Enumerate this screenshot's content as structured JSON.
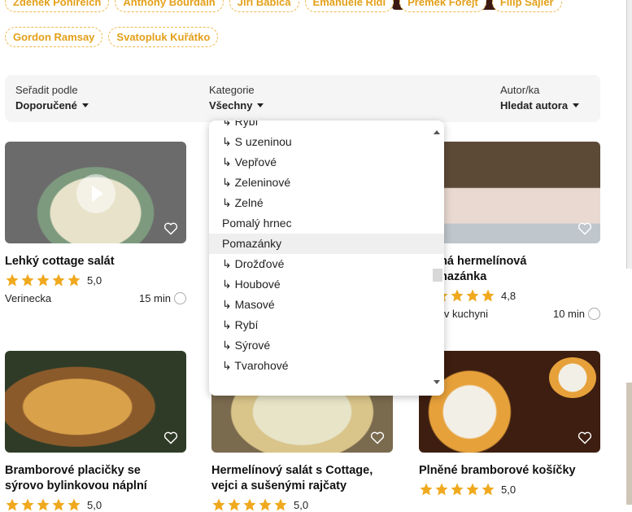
{
  "tags_top": [
    "Zdeněk Pohlreich",
    "Anthony Bourdain",
    "Jiří Babica",
    "Emanuele Ridi",
    "Přemek Forejt",
    "Filip Sajler"
  ],
  "tags_second": [
    "Gordon Ramsay",
    "Svatopluk Kuřátko"
  ],
  "filters": {
    "sort": {
      "label": "Seřadit podle",
      "value": "Doporučené"
    },
    "category": {
      "label": "Kategorie",
      "value": "Všechny"
    },
    "author": {
      "label": "Autor/ka",
      "value": "Hledat autora"
    }
  },
  "dropdown": {
    "items": [
      "↳ Rybí",
      "↳ S uzeninou",
      "↳ Vepřové",
      "↳ Zeleninové",
      "↳ Zelné",
      "Pomalý hrnec",
      "Pomazánky",
      "↳ Drožďové",
      "↳ Houbové",
      "↳ Masové",
      "↳ Rybí",
      "↳ Sýrové",
      "↳ Tvarohové"
    ],
    "selected_index": 6,
    "scroll_fraction": 0.55
  },
  "cards": [
    {
      "title": "Lehký cottage salát",
      "rating": "5,0",
      "stars": 5,
      "author": "Verinecka",
      "time": "15 min",
      "colors": [
        "#7a8f7b",
        "#e7e2c9"
      ]
    },
    {
      "title": "…šná hermelínová …mazánka",
      "title_l1": "šná hermelínová",
      "title_l2": "mazánka",
      "rating": "4,8",
      "stars": 5,
      "author": "a v kuchyni",
      "time": "10 min",
      "colors": [
        "#6d5a44",
        "#e9d9d0"
      ]
    },
    {
      "title": "Bramborové placičky se sýrovo bylinkovou náplní",
      "title_l1": "Bramborové placičky se",
      "title_l2": "sýrovo bylinkovou náplní",
      "rating": "5,0",
      "stars": 5,
      "colors": [
        "#8b5a2b",
        "#d9a14a"
      ]
    },
    {
      "title": "Hermelínový salát s Cottage, vejci a sušenými rajčaty",
      "title_l1": "Hermelínový salát s Cottage,",
      "title_l2": "vejci a sušenými rajčaty",
      "rating": "5,0",
      "stars": 5,
      "colors": [
        "#d9c48a",
        "#e7e4c8"
      ]
    },
    {
      "title": "Plněné bramborové košíčky",
      "rating": "5,0",
      "stars": 5,
      "colors": [
        "#3d1e10",
        "#e7a13a"
      ]
    }
  ],
  "accent": "#f0a91e"
}
